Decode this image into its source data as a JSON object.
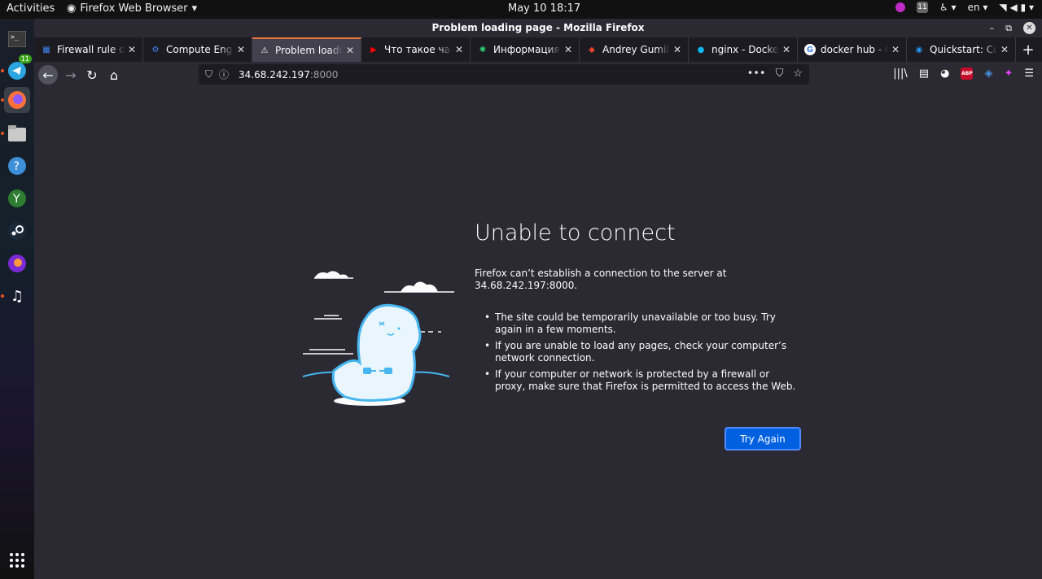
{
  "topbar": {
    "activities": "Activities",
    "app_name": "Firefox Web Browser",
    "clock": "May 10  18:17",
    "notif_count": "11",
    "language": "en"
  },
  "dock": {
    "telegram_badge": "11",
    "items": [
      "terminal-icon",
      "telegram-icon",
      "firefox-icon",
      "files-icon",
      "help-icon",
      "app-icon",
      "steam-icon",
      "firefox-dev-icon",
      "music-icon",
      "app-grid-icon"
    ]
  },
  "window": {
    "title": "Problem loading page - Mozilla Firefox"
  },
  "tabs": [
    {
      "label": "Firewall rule details",
      "fav_color": "#4285f4",
      "fav": "▦"
    },
    {
      "label": "Compute Engine",
      "fav_color": "#4285f4",
      "fav": "⚙"
    },
    {
      "label": "Problem loading page",
      "fav_color": "#42414d",
      "fav": "⚠"
    },
    {
      "label": "Что такое частный",
      "fav_color": "#ff0000",
      "fav": "▶"
    },
    {
      "label": "Информация о",
      "fav_color": "#2ecc71",
      "fav": "✱"
    },
    {
      "label": "Andrey Gumilev",
      "fav_color": "#e24329",
      "fav": "◆"
    },
    {
      "label": "nginx - Docker Hub",
      "fav_color": "#0db7ed",
      "fav": "●"
    },
    {
      "label": "docker hub - Google",
      "fav_color": "#ffffff",
      "fav": "G"
    },
    {
      "label": "Quickstart: Compose",
      "fav_color": "#2496ed",
      "fav": "◉"
    }
  ],
  "urlbar": {
    "host": "34.68.242.197",
    "port": ":8000"
  },
  "error": {
    "title": "Unable to connect",
    "description": "Firefox can’t establish a connection to the server at 34.68.242.197:8000.",
    "bullets": [
      "The site could be temporarily unavailable or too busy. Try again in a few moments.",
      "If you are unable to load any pages, check your computer’s network connection.",
      "If your computer or network is protected by a firewall or proxy, make sure that Firefox is permitted to access the Web."
    ],
    "button": "Try Again"
  }
}
